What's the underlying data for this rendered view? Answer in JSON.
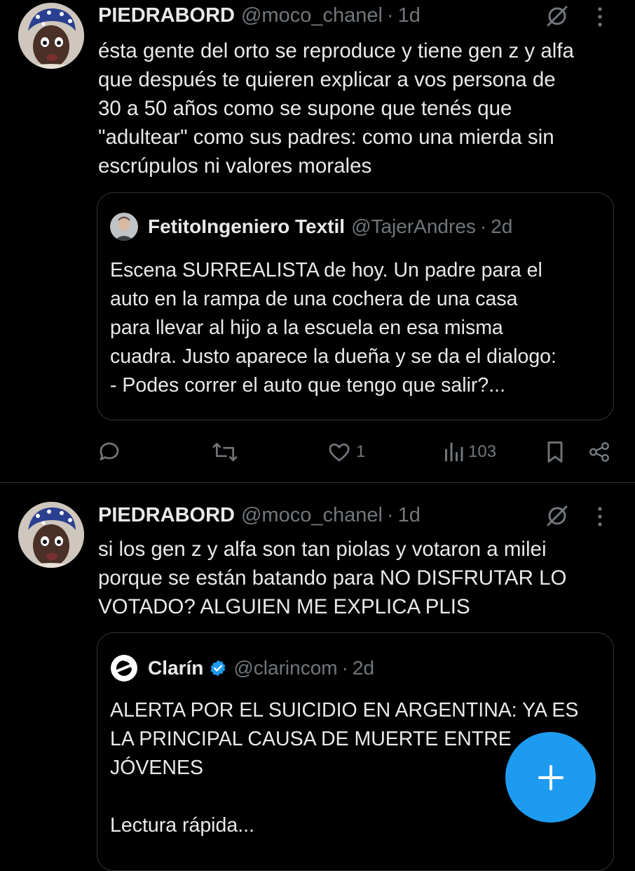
{
  "tweets": [
    {
      "author_name": "PIEDRABORD",
      "handle": "@moco_chanel",
      "separator": "·",
      "time": "1d",
      "text": "ésta gente del orto se reproduce y tiene gen z y alfa\nque después te quieren explicar a vos persona de\n30 a 50 años como se supone que tenés que\n\"adultear\" como sus padres: como una mierda sin\nescrúpulos ni valores morales",
      "quote": {
        "author_name": "FetitoIngeniero Textil",
        "handle": "@TajerAndres",
        "separator": "·",
        "time": "2d",
        "text": "Escena SURREALISTA de hoy. Un padre para el\nauto en la rampa de una cochera de una casa\npara llevar al hijo a la escuela en esa misma\ncuadra. Justo aparece la dueña y se da el dialogo:\n- Podes correr el auto que tengo que salir?..."
      },
      "actions": {
        "likes": "1",
        "views": "103"
      }
    },
    {
      "author_name": "PIEDRABORD",
      "handle": "@moco_chanel",
      "separator": "·",
      "time": "1d",
      "text": "si los gen z y alfa son tan piolas y votaron a milei\nporque se están batando para NO DISFRUTAR LO\nVOTADO? ALGUIEN ME EXPLICA PLIS",
      "quote": {
        "author_name": "Clarín",
        "handle": "@clarincom",
        "separator": "·",
        "time": "2d",
        "text": "ALERTA POR EL SUICIDIO EN ARGENTINA: YA ES\nLA PRINCIPAL CAUSA DE MUERTE ENTRE\nJÓVENES\n\nLectura rápida..."
      }
    }
  ],
  "icons": {
    "grok": "grok-icon",
    "more": "more-vertical-icon",
    "reply": "reply-icon",
    "retweet": "retweet-icon",
    "like": "heart-icon",
    "views": "views-icon",
    "bookmark": "bookmark-icon",
    "share": "share-icon",
    "compose": "plus-icon",
    "verified": "verified-badge-icon"
  },
  "colors": {
    "background": "#000000",
    "text_primary": "#e7e9ea",
    "text_secondary": "#71767b",
    "border": "#2f3336",
    "accent": "#1d9bf0"
  }
}
